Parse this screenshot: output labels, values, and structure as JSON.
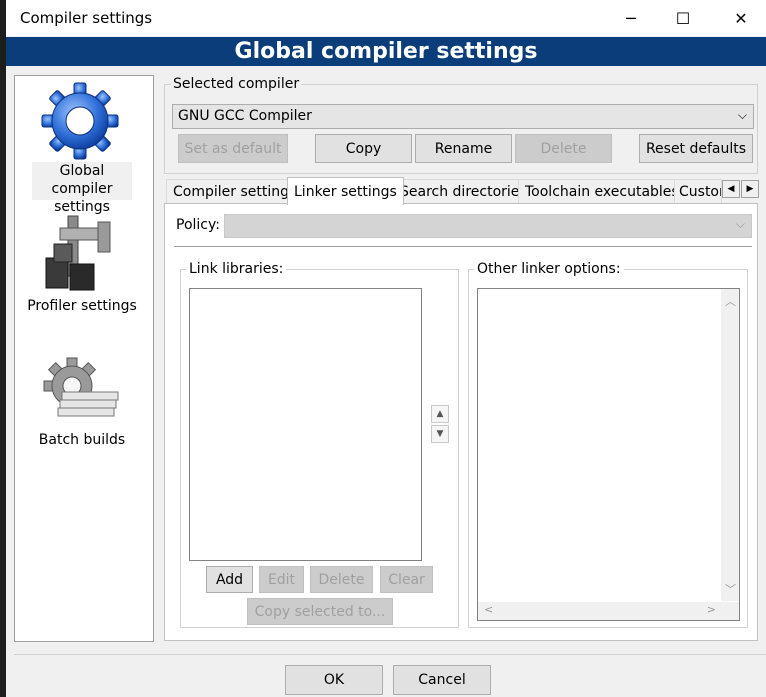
{
  "window": {
    "title": "Compiler settings",
    "minimize": "─",
    "maximize": "☐",
    "close": "✕"
  },
  "banner": {
    "title": "Global compiler settings"
  },
  "sidebar": {
    "items": [
      {
        "label_line1": "Global compiler",
        "label_line2": "settings",
        "icon": "gear-icon",
        "selected": true
      },
      {
        "label_line1": "Profiler settings",
        "icon": "caliper-profiler-icon",
        "selected": false
      },
      {
        "label_line1": "Batch builds",
        "icon": "gear-stack-icon",
        "selected": false
      }
    ]
  },
  "selected_compiler": {
    "label": "Selected compiler",
    "value": "GNU GCC Compiler"
  },
  "compiler_buttons": {
    "set_default": "Set as default",
    "copy": "Copy",
    "rename": "Rename",
    "delete": "Delete",
    "reset": "Reset defaults"
  },
  "tabs": [
    {
      "label": "Compiler settings",
      "active": false
    },
    {
      "label": "Linker settings",
      "active": true
    },
    {
      "label": "Search directories",
      "active": false
    },
    {
      "label": "Toolchain executables",
      "active": false
    },
    {
      "label": "Custor",
      "active": false
    }
  ],
  "policy": {
    "label": "Policy:",
    "value": ""
  },
  "link_libraries": {
    "label": "Link libraries:",
    "items": []
  },
  "other_linker": {
    "label": "Other linker options:",
    "value": ""
  },
  "lib_buttons": {
    "add": "Add",
    "edit": "Edit",
    "delete": "Delete",
    "clear": "Clear",
    "copy_selected": "Copy selected to..."
  },
  "footer": {
    "ok": "OK",
    "cancel": "Cancel"
  },
  "colors": {
    "banner": "#0a3d7a",
    "window_bg": "#f0f0f0"
  }
}
